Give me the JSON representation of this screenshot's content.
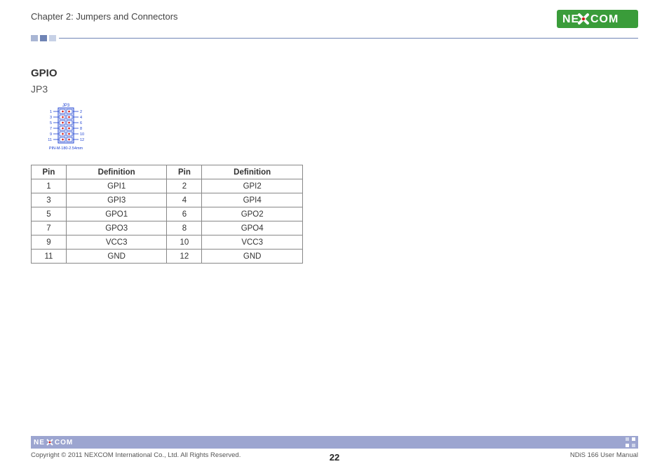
{
  "header": {
    "chapter_title": "Chapter 2: Jumpers and Connectors",
    "logo_text": "NEXCOM"
  },
  "section": {
    "title": "GPIO",
    "subtitle": "JP3"
  },
  "diagram": {
    "label_top": "JP3",
    "label_bottom": "PIN-M-180-2.54mm",
    "left_pins": [
      "1",
      "3",
      "5",
      "7",
      "9",
      "11"
    ],
    "right_pins": [
      "2",
      "4",
      "6",
      "8",
      "10",
      "12"
    ]
  },
  "table": {
    "headers": {
      "pin": "Pin",
      "definition": "Definition"
    },
    "rows": [
      {
        "p1": "1",
        "d1": "GPI1",
        "p2": "2",
        "d2": "GPI2"
      },
      {
        "p1": "3",
        "d1": "GPI3",
        "p2": "4",
        "d2": "GPI4"
      },
      {
        "p1": "5",
        "d1": "GPO1",
        "p2": "6",
        "d2": "GPO2"
      },
      {
        "p1": "7",
        "d1": "GPO3",
        "p2": "8",
        "d2": "GPO4"
      },
      {
        "p1": "9",
        "d1": "VCC3",
        "p2": "10",
        "d2": "VCC3"
      },
      {
        "p1": "11",
        "d1": "GND",
        "p2": "12",
        "d2": "GND"
      }
    ]
  },
  "footer": {
    "logo_text": "NE COM",
    "copyright": "Copyright © 2011 NEXCOM International Co., Ltd. All Rights Reserved.",
    "page_number": "22",
    "manual_ref": "NDiS 166 User Manual"
  },
  "colors": {
    "brand_green": "#3a9c3a",
    "accent_blue": "#6f84b5",
    "footer_bar": "#9ca5d0",
    "diagram_blue": "#1a3fd1",
    "diagram_red": "#d11a1a"
  }
}
